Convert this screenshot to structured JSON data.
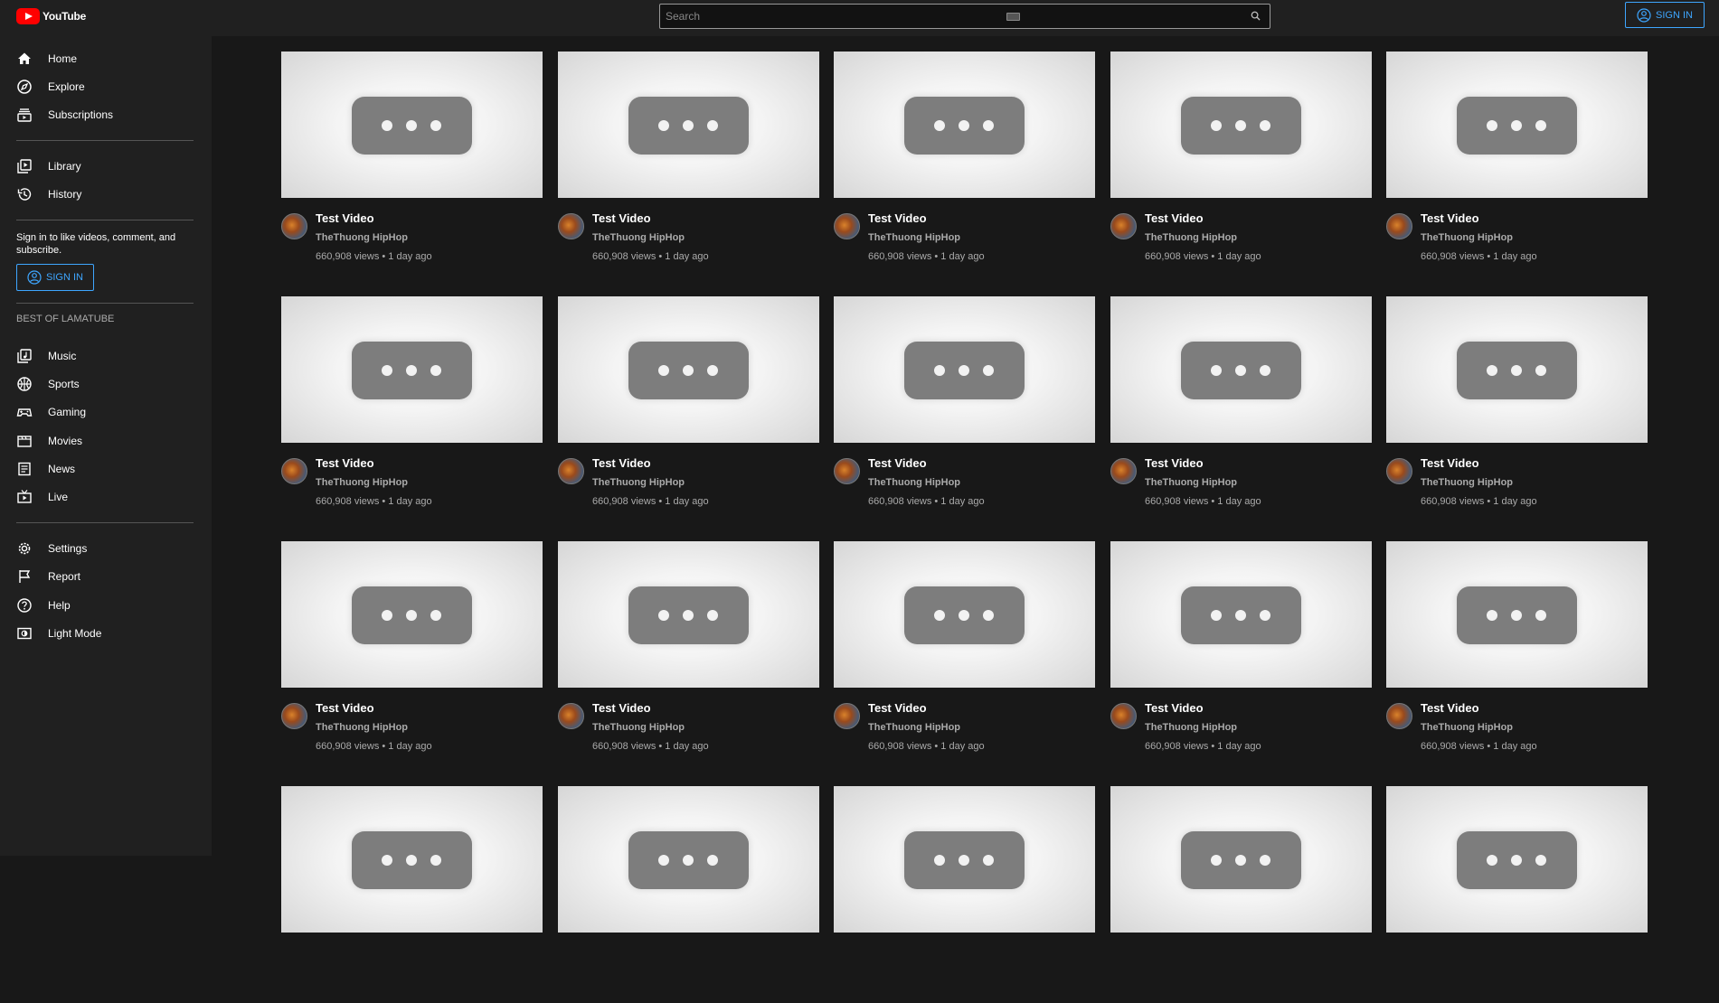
{
  "app": {
    "name": "YouTube"
  },
  "search": {
    "placeholder": "Search"
  },
  "header": {
    "sign_in_label": "SIGN IN"
  },
  "sidebar": {
    "primary": [
      {
        "label": "Home",
        "icon": "home-icon"
      },
      {
        "label": "Explore",
        "icon": "compass-icon"
      },
      {
        "label": "Subscriptions",
        "icon": "subscriptions-icon"
      }
    ],
    "secondary": [
      {
        "label": "Library",
        "icon": "library-icon"
      },
      {
        "label": "History",
        "icon": "history-icon"
      }
    ],
    "sign_in_prompt": "Sign in to like videos, comment, and subscribe.",
    "sign_in_label": "SIGN IN",
    "best_of_title": "BEST OF LAMATUBE",
    "best_of": [
      {
        "label": "Music",
        "icon": "music-icon"
      },
      {
        "label": "Sports",
        "icon": "sports-icon"
      },
      {
        "label": "Gaming",
        "icon": "gamepad-icon"
      },
      {
        "label": "Movies",
        "icon": "movies-icon"
      },
      {
        "label": "News",
        "icon": "news-icon"
      },
      {
        "label": "Live",
        "icon": "live-icon"
      }
    ],
    "footer": [
      {
        "label": "Settings",
        "icon": "gear-icon"
      },
      {
        "label": "Report",
        "icon": "flag-icon"
      },
      {
        "label": "Help",
        "icon": "help-icon"
      },
      {
        "label": "Light Mode",
        "icon": "light-mode-icon"
      }
    ]
  },
  "videos": [
    {
      "title": "Test Video",
      "channel": "TheThuong HipHop",
      "meta": "660,908 views • 1 day ago"
    },
    {
      "title": "Test Video",
      "channel": "TheThuong HipHop",
      "meta": "660,908 views • 1 day ago"
    },
    {
      "title": "Test Video",
      "channel": "TheThuong HipHop",
      "meta": "660,908 views • 1 day ago"
    },
    {
      "title": "Test Video",
      "channel": "TheThuong HipHop",
      "meta": "660,908 views • 1 day ago"
    },
    {
      "title": "Test Video",
      "channel": "TheThuong HipHop",
      "meta": "660,908 views • 1 day ago"
    },
    {
      "title": "Test Video",
      "channel": "TheThuong HipHop",
      "meta": "660,908 views • 1 day ago"
    },
    {
      "title": "Test Video",
      "channel": "TheThuong HipHop",
      "meta": "660,908 views • 1 day ago"
    },
    {
      "title": "Test Video",
      "channel": "TheThuong HipHop",
      "meta": "660,908 views • 1 day ago"
    },
    {
      "title": "Test Video",
      "channel": "TheThuong HipHop",
      "meta": "660,908 views • 1 day ago"
    },
    {
      "title": "Test Video",
      "channel": "TheThuong HipHop",
      "meta": "660,908 views • 1 day ago"
    },
    {
      "title": "Test Video",
      "channel": "TheThuong HipHop",
      "meta": "660,908 views • 1 day ago"
    },
    {
      "title": "Test Video",
      "channel": "TheThuong HipHop",
      "meta": "660,908 views • 1 day ago"
    },
    {
      "title": "Test Video",
      "channel": "TheThuong HipHop",
      "meta": "660,908 views • 1 day ago"
    },
    {
      "title": "Test Video",
      "channel": "TheThuong HipHop",
      "meta": "660,908 views • 1 day ago"
    },
    {
      "title": "Test Video",
      "channel": "TheThuong HipHop",
      "meta": "660,908 views • 1 day ago"
    },
    {
      "title": "",
      "channel": "",
      "meta": ""
    },
    {
      "title": "",
      "channel": "",
      "meta": ""
    },
    {
      "title": "",
      "channel": "",
      "meta": ""
    },
    {
      "title": "",
      "channel": "",
      "meta": ""
    },
    {
      "title": "",
      "channel": "",
      "meta": ""
    }
  ],
  "colors": {
    "accent": "#3ea6ff",
    "brand": "#ff0000",
    "sidebar_bg": "#202020",
    "page_bg": "#181818"
  }
}
